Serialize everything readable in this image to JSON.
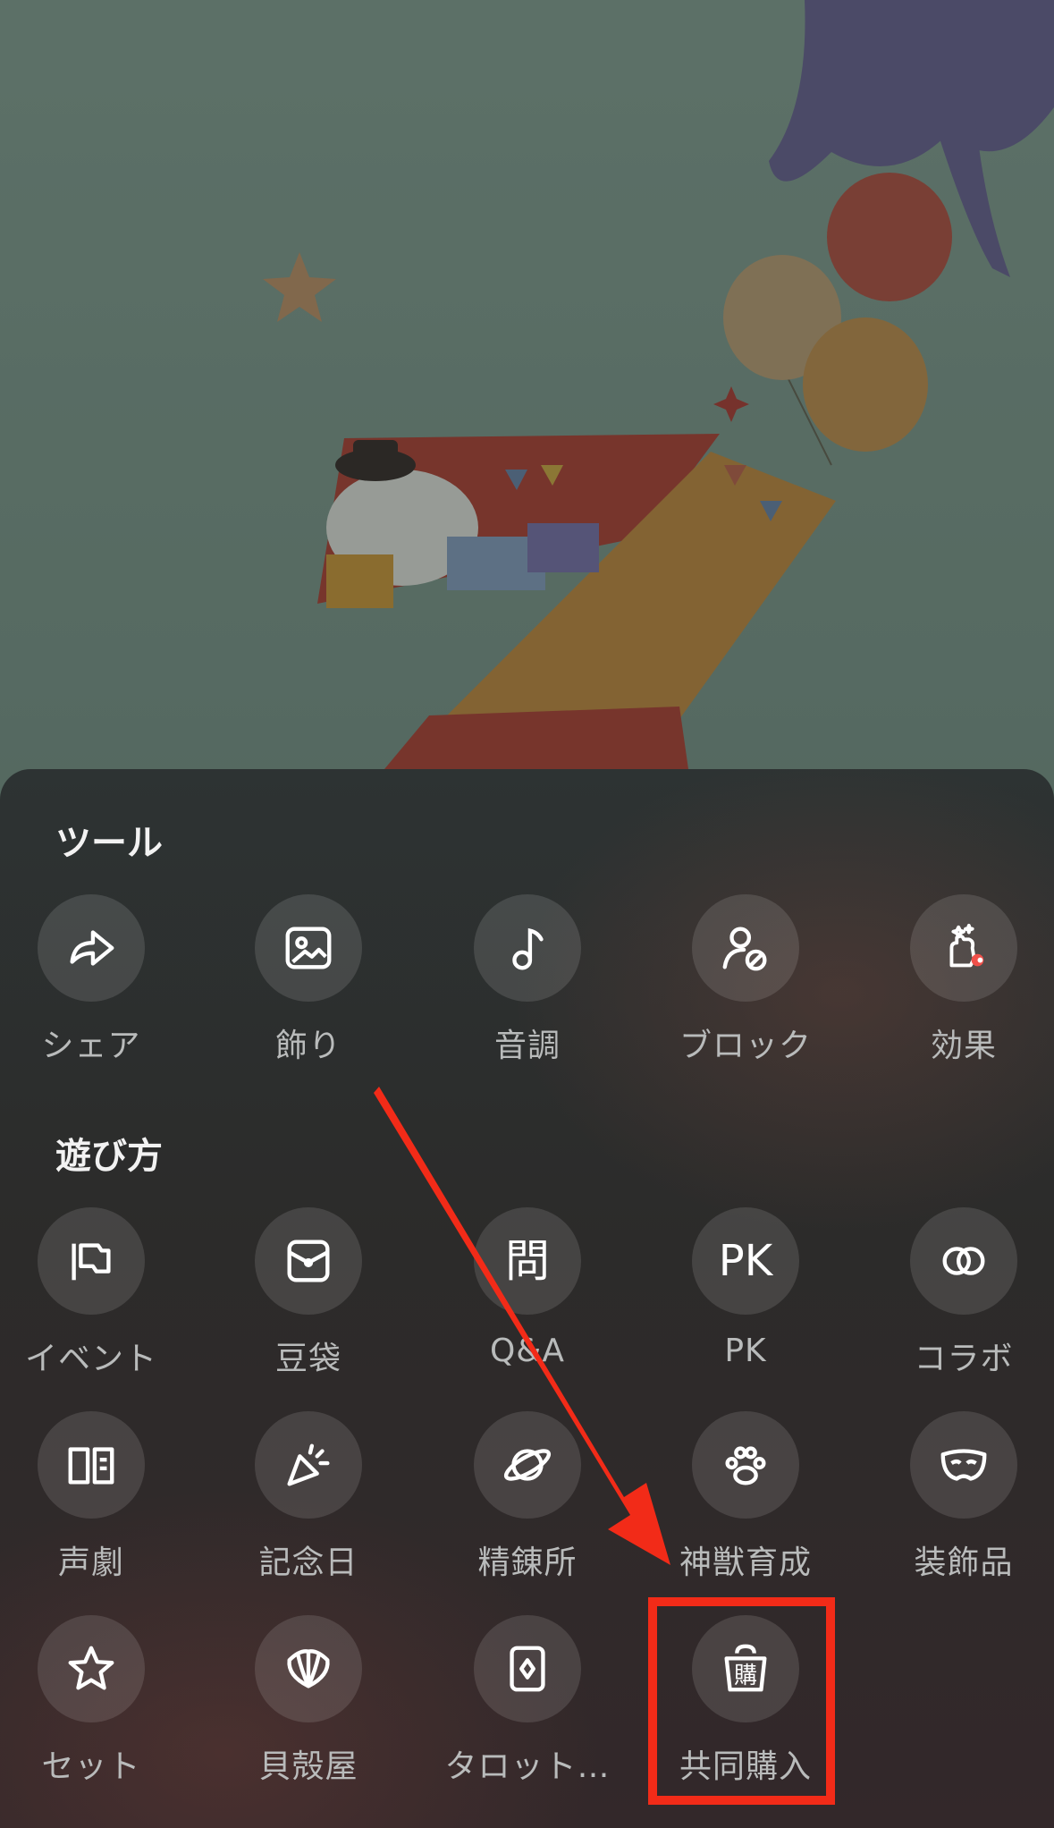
{
  "colors": {
    "accent_red": "#f22b18",
    "sheet_top": "#2d3333",
    "label_gray": "#b9bbbb",
    "icon_bg": "rgba(255,255,255,0.12)"
  },
  "sheet": {
    "tools_title": "ツール",
    "play_title": "遊び方",
    "tools": [
      {
        "label": "シェア",
        "icon": "share-icon"
      },
      {
        "label": "飾り",
        "icon": "image-frame-icon"
      },
      {
        "label": "音調",
        "icon": "music-note-icon"
      },
      {
        "label": "ブロック",
        "icon": "block-user-icon"
      },
      {
        "label": "効果",
        "icon": "effect-hand-icon"
      }
    ],
    "play": [
      {
        "label": "イベント",
        "icon": "flag-icon"
      },
      {
        "label": "豆袋",
        "icon": "bean-bag-icon"
      },
      {
        "label": "Q&A",
        "icon": "question-kanji-icon",
        "glyph": "問"
      },
      {
        "label": "PK",
        "icon": "pk-icon",
        "glyph": "PK"
      },
      {
        "label": "コラボ",
        "icon": "collab-rings-icon"
      },
      {
        "label": "声劇",
        "icon": "book-icon"
      },
      {
        "label": "記念日",
        "icon": "party-popper-icon"
      },
      {
        "label": "精錬所",
        "icon": "planet-icon"
      },
      {
        "label": "神獣育成",
        "icon": "paw-icon"
      },
      {
        "label": "装飾品",
        "icon": "mask-icon"
      },
      {
        "label": "セット",
        "icon": "star-icon"
      },
      {
        "label": "貝殻屋",
        "icon": "shell-icon"
      },
      {
        "label": "タロット…",
        "icon": "tarot-card-icon"
      },
      {
        "label": "共同購入",
        "icon": "group-buy-bag-icon",
        "glyph": "購"
      }
    ]
  }
}
